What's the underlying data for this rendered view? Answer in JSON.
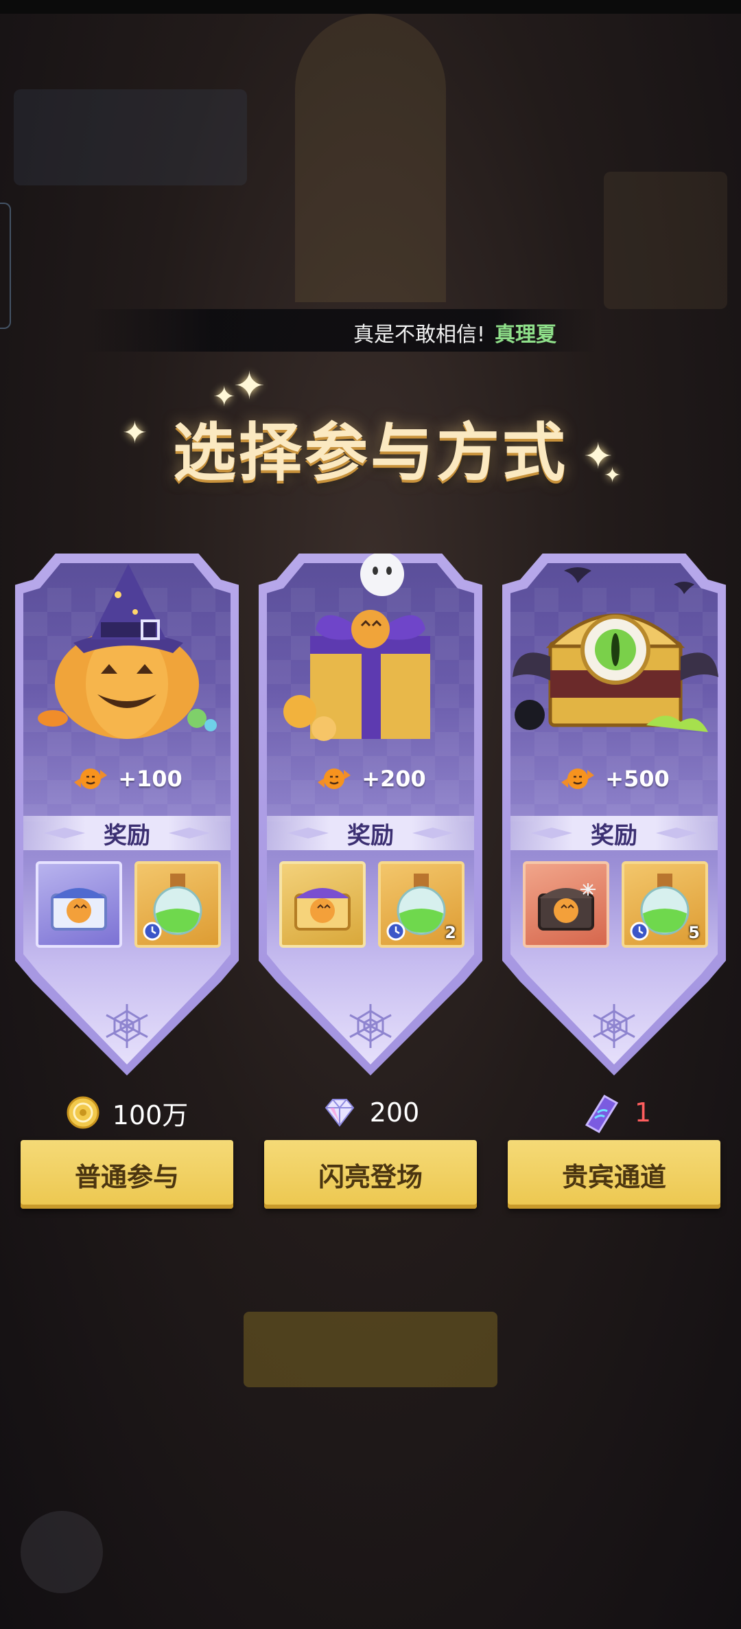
{
  "dialog": {
    "text": "真是不敢相信!",
    "speaker": "真理夏"
  },
  "title": "选择参与方式",
  "reward_label": "奖励",
  "cards": [
    {
      "candy_bonus": "+100",
      "item2_count": "",
      "cost_value": "100万",
      "cost_icon": "gold-coin-icon",
      "button": "普通参与"
    },
    {
      "candy_bonus": "+200",
      "item2_count": "2",
      "cost_value": "200",
      "cost_icon": "diamond-icon",
      "button": "闪亮登场"
    },
    {
      "candy_bonus": "+500",
      "item2_count": "5",
      "cost_value": "1",
      "cost_icon": "vip-ticket-icon",
      "button": "贵宾通道"
    }
  ],
  "colors": {
    "accent_gold": "#ecc74f",
    "card_purple": "#6a5cab",
    "speaker_green": "#8fe08a",
    "cost_red": "#ff5e5e"
  }
}
